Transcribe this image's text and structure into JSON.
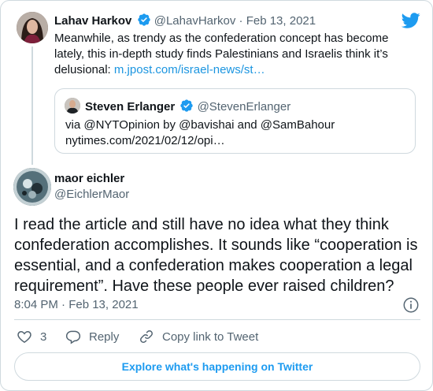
{
  "parent_tweet": {
    "name": "Lahav Harkov",
    "handle": "@LahavHarkov",
    "separator": "·",
    "date": "Feb 13, 2021",
    "text": "Meanwhile, as trendy as the confederation concept has become lately, this in-depth study finds Palestinians and Israelis think it’s delusional: ",
    "link": "m.jpost.com/israel-news/st…"
  },
  "quoted_tweet": {
    "name": "Steven Erlanger",
    "handle": "@StevenErlanger",
    "line1": "via @NYTOpinion by @bavishai and @SamBahour",
    "line2": "nytimes.com/2021/02/12/opi…"
  },
  "main_tweet": {
    "name": "maor eichler",
    "handle": "@EichlerMaor",
    "text": "I read the article and still have no idea what they think confederation accomplishes. It sounds like “cooperation is essential, and a confederation makes cooperation a legal requirement”. Have these people ever raised children?",
    "timestamp": "8:04 PM · Feb 13, 2021"
  },
  "actions": {
    "like_count": "3",
    "reply_label": "Reply",
    "copy_link_label": "Copy link to Tweet"
  },
  "explore_label": "Explore what's happening on Twitter",
  "icons": [
    "verified-badge-icon",
    "twitter-bird-icon",
    "info-icon",
    "heart-icon",
    "reply-bubble-icon",
    "link-icon"
  ],
  "colors": {
    "accent": "#1d9bf0",
    "link": "#1b95e0",
    "secondary_text": "#536471",
    "border": "#cfd9de"
  }
}
